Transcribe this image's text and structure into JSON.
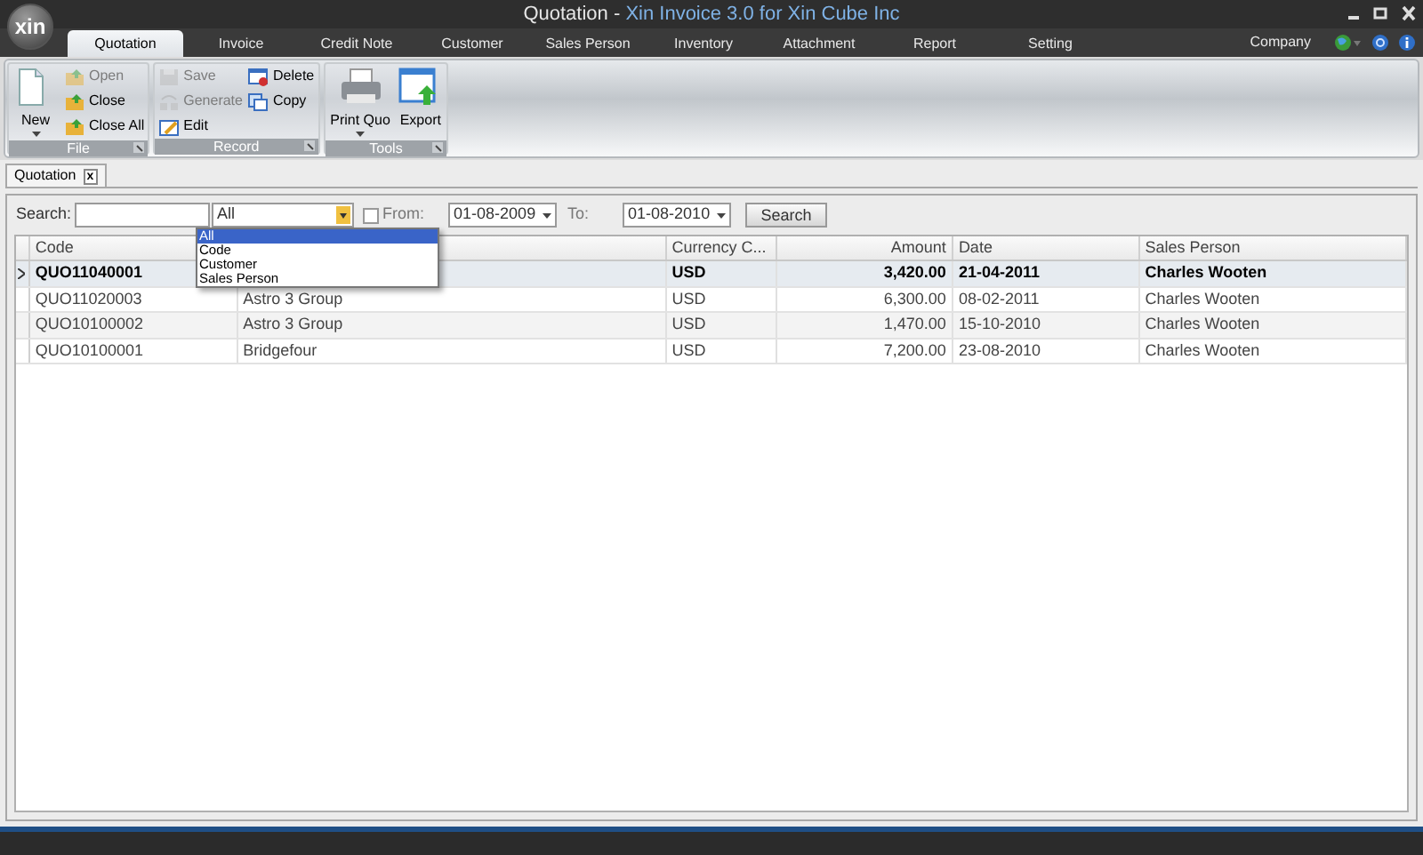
{
  "window": {
    "logo_text": "xin",
    "title_document": "Quotation - ",
    "title_app": "Xin Invoice 3.0 for Xin Cube Inc"
  },
  "menu_tabs": [
    {
      "label": "Quotation",
      "selected": true
    },
    {
      "label": "Invoice",
      "selected": false
    },
    {
      "label": "Credit Note",
      "selected": false
    },
    {
      "label": "Customer",
      "selected": false
    },
    {
      "label": "Sales Person",
      "selected": false
    },
    {
      "label": "Inventory",
      "selected": false
    },
    {
      "label": "Attachment",
      "selected": false
    },
    {
      "label": "Report",
      "selected": false
    },
    {
      "label": "Setting",
      "selected": false
    }
  ],
  "company": "Company",
  "ribbon": [
    {
      "title": "File",
      "columns": [
        [
          {
            "label": "New",
            "kind": "large",
            "disabled": false,
            "dropdown": true
          }
        ],
        [
          {
            "label": "Open",
            "kind": "small",
            "disabled": true
          },
          {
            "label": "Close",
            "kind": "small",
            "disabled": false
          },
          {
            "label": "Close All",
            "kind": "small",
            "disabled": false
          }
        ]
      ]
    },
    {
      "title": "Record",
      "columns": [
        [
          {
            "label": "Save",
            "kind": "small",
            "disabled": true
          },
          {
            "label": "Generate",
            "kind": "small",
            "disabled": true
          },
          {
            "label": "Edit",
            "kind": "small",
            "disabled": false
          }
        ],
        [
          {
            "label": "Delete",
            "kind": "small",
            "disabled": false
          },
          {
            "label": "Copy",
            "kind": "small",
            "disabled": false
          }
        ]
      ]
    },
    {
      "title": "Tools",
      "columns": [
        [
          {
            "label": "Print Quo",
            "kind": "large",
            "disabled": false,
            "dropdown": true
          }
        ],
        [
          {
            "label": "Export",
            "kind": "large",
            "disabled": false,
            "dropdown": false
          }
        ]
      ]
    }
  ],
  "document_tab": {
    "label": "Quotation",
    "close": "x"
  },
  "filter": {
    "search_label": "Search:",
    "field": "All",
    "options": [
      {
        "label": "All",
        "selected": true
      },
      {
        "label": "Code",
        "selected": false
      },
      {
        "label": "Customer",
        "selected": false
      },
      {
        "label": "Sales Person",
        "selected": false
      }
    ],
    "from_label": "From:",
    "from_checked": false,
    "from_date": "01-08-2009",
    "to_label": "To:",
    "to_date": "01-08-2010",
    "search_button": "Search"
  },
  "grid": {
    "columns": [
      {
        "label": "Code"
      },
      {},
      {
        "label": "Currency C..."
      },
      {
        "label": "Amount"
      },
      {
        "label": "Date"
      },
      {
        "label": "Sales Person"
      }
    ],
    "rows": [
      {
        "current": true,
        "cells": [
          "QUO11040001",
          "",
          "USD",
          "3,420.00",
          "21-04-2011",
          "Charles Wooten"
        ]
      },
      {
        "current": false,
        "cells": [
          "QUO11020003",
          "Astro 3 Group",
          "USD",
          "6,300.00",
          "08-02-2011",
          "Charles Wooten"
        ]
      },
      {
        "current": false,
        "cells": [
          "QUO10100002",
          "Astro 3 Group",
          "USD",
          "1,470.00",
          "15-10-2010",
          "Charles Wooten"
        ]
      },
      {
        "current": false,
        "cells": [
          "QUO10100001",
          "Bridgefour",
          "USD",
          "7,200.00",
          "23-08-2010",
          "Charles Wooten"
        ]
      }
    ]
  }
}
